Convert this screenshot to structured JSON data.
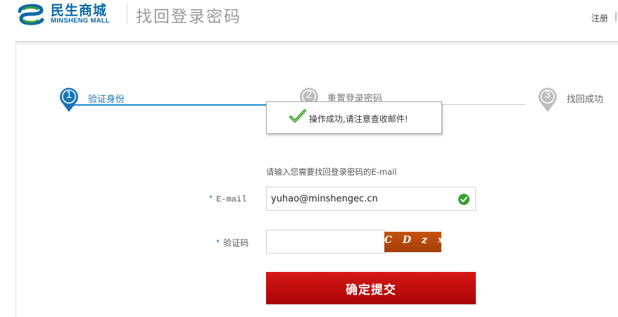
{
  "header": {
    "logo_cn": "民生商城",
    "logo_en": "MINSHENG MALL",
    "page_title": "找回登录密码",
    "register_link": "注册",
    "separator": "|"
  },
  "steps": [
    {
      "number": "1",
      "label": "验证身份",
      "state": "active"
    },
    {
      "number": "2",
      "label": "重置登录密码",
      "state": "inactive"
    },
    {
      "number": "3",
      "label": "找回成功",
      "state": "inactive"
    }
  ],
  "toast": {
    "message": "操作成功,请注意查收邮件!",
    "icon": "check-icon"
  },
  "form": {
    "instruction": "请输入您需要找回登录密码的E-mail",
    "email_label": "E-mail",
    "email_value": "yuhao@minshengec.cn",
    "email_status_icon": "check-circle-icon",
    "captcha_label": "验证码",
    "captcha_value": "",
    "captcha_image_text": "C D z x",
    "required_mark": "*",
    "submit_label": "确定提交"
  },
  "colors": {
    "brand_blue": "#0a68a8",
    "step_active": "#1a8ccf",
    "submit_red": "#c10d0d",
    "success_green": "#3aa02e",
    "captcha_bg": "#b3470a"
  }
}
